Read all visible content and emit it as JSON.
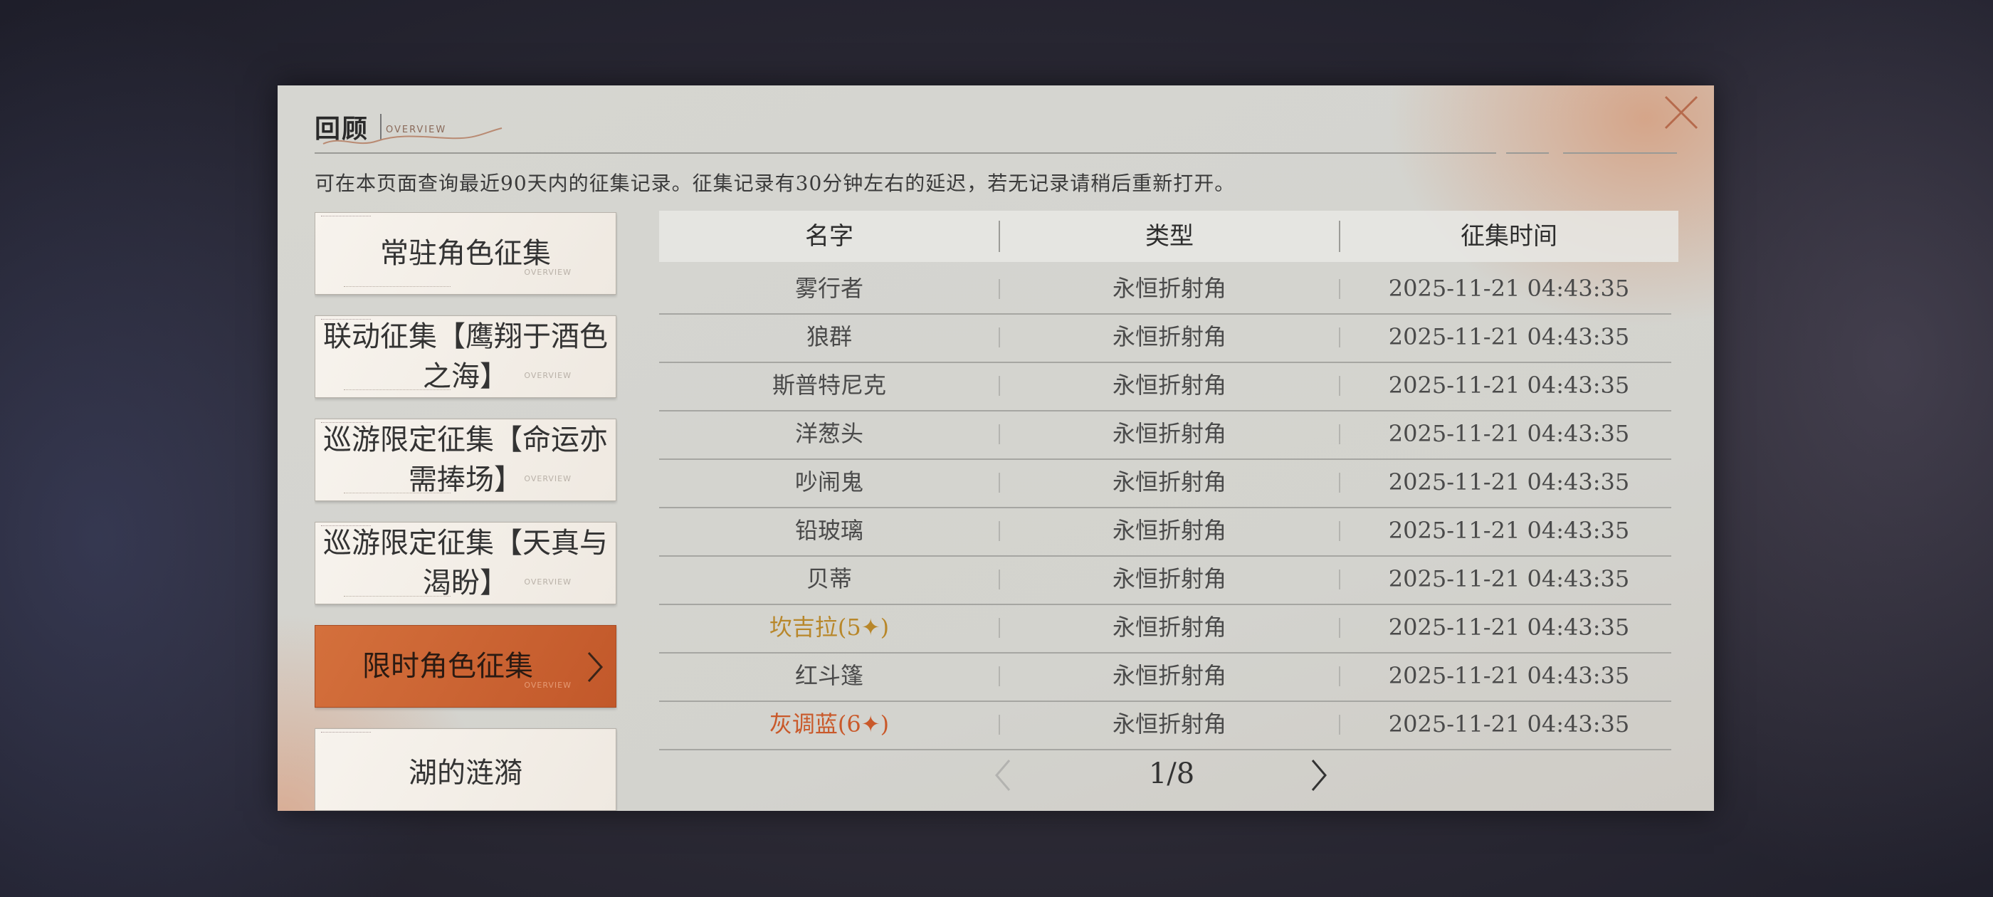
{
  "header": {
    "title": "回顾",
    "subtitle": "OVERVIEW",
    "description": "可在本页面查询最近90天内的征集记录。征集记录有30分钟左右的延迟，若无记录请稍后重新打开。"
  },
  "sidebar": {
    "item_overview_tag": "OVERVIEW",
    "items": [
      {
        "label": "常驻角色征集",
        "active": false
      },
      {
        "label": "联动征集【鹰翔于酒色之海】",
        "active": false
      },
      {
        "label": "巡游限定征集【命运亦需捧场】",
        "active": false
      },
      {
        "label": "巡游限定征集【天真与渴盼】",
        "active": false
      },
      {
        "label": "限时角色征集",
        "active": true
      },
      {
        "label": "湖的涟漪",
        "active": false
      }
    ]
  },
  "table": {
    "columns": [
      "名字",
      "类型",
      "征集时间"
    ],
    "rows": [
      {
        "name": "雾行者",
        "type": "永恒折射角",
        "time": "2025-11-21 04:43:35",
        "rarity": "normal"
      },
      {
        "name": "狼群",
        "type": "永恒折射角",
        "time": "2025-11-21 04:43:35",
        "rarity": "normal"
      },
      {
        "name": "斯普特尼克",
        "type": "永恒折射角",
        "time": "2025-11-21 04:43:35",
        "rarity": "normal"
      },
      {
        "name": "洋葱头",
        "type": "永恒折射角",
        "time": "2025-11-21 04:43:35",
        "rarity": "normal"
      },
      {
        "name": "吵闹鬼",
        "type": "永恒折射角",
        "time": "2025-11-21 04:43:35",
        "rarity": "normal"
      },
      {
        "name": "铅玻璃",
        "type": "永恒折射角",
        "time": "2025-11-21 04:43:35",
        "rarity": "normal"
      },
      {
        "name": "贝蒂",
        "type": "永恒折射角",
        "time": "2025-11-21 04:43:35",
        "rarity": "normal"
      },
      {
        "name": "坎吉拉(5✦)",
        "type": "永恒折射角",
        "time": "2025-11-21 04:43:35",
        "rarity": "rarity4"
      },
      {
        "name": "红斗篷",
        "type": "永恒折射角",
        "time": "2025-11-21 04:43:35",
        "rarity": "normal"
      },
      {
        "name": "灰调蓝(6✦)",
        "type": "永恒折射角",
        "time": "2025-11-21 04:43:35",
        "rarity": "rarity5"
      }
    ]
  },
  "pagination": {
    "text": "1/8",
    "current": 1,
    "total": 8
  },
  "icons": {
    "close": "close-icon",
    "prev": "chevron-left-icon",
    "next": "chevron-right-icon",
    "active_item": "chevron-right-icon"
  },
  "colors": {
    "accent": "#c9602f",
    "rarity4": "#b8872a",
    "rarity5": "#c9592a"
  }
}
